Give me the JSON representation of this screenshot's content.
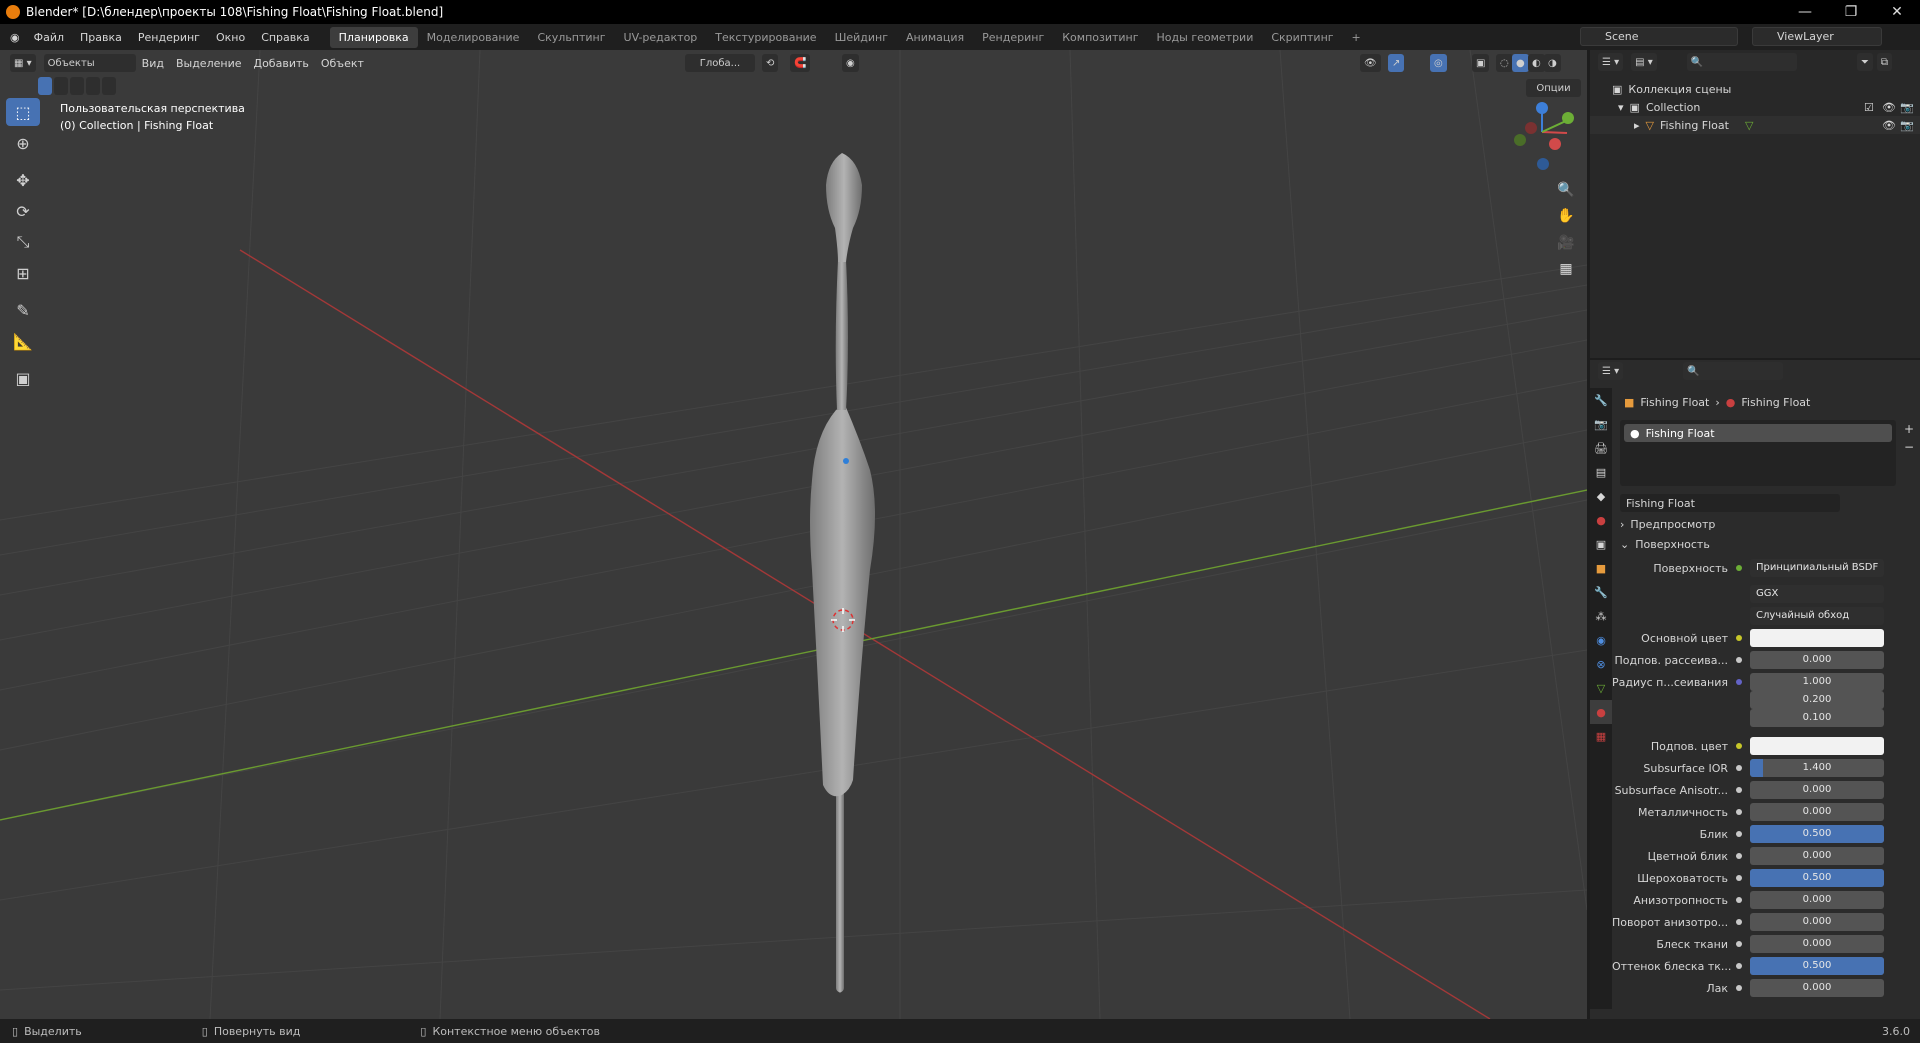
{
  "window": {
    "title": "Blender* [D:\\блендер\\проекты 108\\Fishing Float\\Fishing Float.blend]",
    "version": "3.6.0"
  },
  "menu": {
    "items": [
      "Файл",
      "Правка",
      "Рендеринг",
      "Окно",
      "Справка"
    ],
    "workspaces": [
      "Планировка",
      "Моделирование",
      "Скульптинг",
      "UV-редактор",
      "Текстурирование",
      "Шейдинг",
      "Анимация",
      "Рендеринг",
      "Композитинг",
      "Ноды геометрии",
      "Скриптинг",
      "+"
    ],
    "active_workspace": "Планировка",
    "scene": "Scene",
    "view_layer": "ViewLayer"
  },
  "viewport": {
    "mode": "Объекты",
    "menus": [
      "Вид",
      "Выделение",
      "Добавить",
      "Объект"
    ],
    "transform_orientation": "Глоба...",
    "options_label": "Опции",
    "view_name": "Пользовательская перспектива",
    "collection_label": "(0) Collection | Fishing Float"
  },
  "outliner": {
    "scene_collection": "Коллекция сцены",
    "collection": "Collection",
    "object": "Fishing Float"
  },
  "properties": {
    "breadcrumb_object": "Fishing Float",
    "breadcrumb_material": "Fishing Float",
    "material_slot": "Fishing Float",
    "material_name": "Fishing Float",
    "panel_preview": "Предпросмотр",
    "panel_surface": "Поверхность",
    "surface_label": "Поверхность",
    "surface_value": "Принципиальный BSDF",
    "distribution": "GGX",
    "subsurface_method": "Случайный обход",
    "rows": [
      {
        "label": "Основной цвет",
        "value": "",
        "type": "color",
        "dot": "yel"
      },
      {
        "label": "Подпов. рассеива...",
        "value": "0.000",
        "fill": 0,
        "dot": "gray"
      },
      {
        "label": "Радиус п...сеивания",
        "value": "1.000",
        "fill": 0,
        "dot": "pur"
      },
      {
        "label": "",
        "value": "0.200",
        "fill": 0,
        "dot": "none"
      },
      {
        "label": "",
        "value": "0.100",
        "fill": 0,
        "dot": "none"
      },
      {
        "label": "Подпов. цвет",
        "value": "",
        "type": "color",
        "dot": "yel"
      },
      {
        "label": "Subsurface IOR",
        "value": "1.400",
        "fill": 0.1,
        "dot": "gray"
      },
      {
        "label": "Subsurface Anisotr...",
        "value": "0.000",
        "fill": 0,
        "dot": "gray"
      },
      {
        "label": "Металличность",
        "value": "0.000",
        "fill": 0,
        "dot": "gray"
      },
      {
        "label": "Блик",
        "value": "0.500",
        "fill": 1,
        "dot": "gray"
      },
      {
        "label": "Цветной блик",
        "value": "0.000",
        "fill": 0,
        "dot": "gray"
      },
      {
        "label": "Шероховатость",
        "value": "0.500",
        "fill": 1,
        "dot": "gray"
      },
      {
        "label": "Анизотропность",
        "value": "0.000",
        "fill": 0,
        "dot": "gray"
      },
      {
        "label": "Поворот анизотро...",
        "value": "0.000",
        "fill": 0,
        "dot": "gray"
      },
      {
        "label": "Блеск ткани",
        "value": "0.000",
        "fill": 0,
        "dot": "gray"
      },
      {
        "label": "Оттенок блеска тк...",
        "value": "0.500",
        "fill": 1,
        "dot": "gray"
      },
      {
        "label": "Лак",
        "value": "0.000",
        "fill": 0,
        "dot": "gray"
      }
    ]
  },
  "status": {
    "select": "Выделить",
    "rotate": "Повернуть вид",
    "context": "Контекстное меню объектов"
  }
}
